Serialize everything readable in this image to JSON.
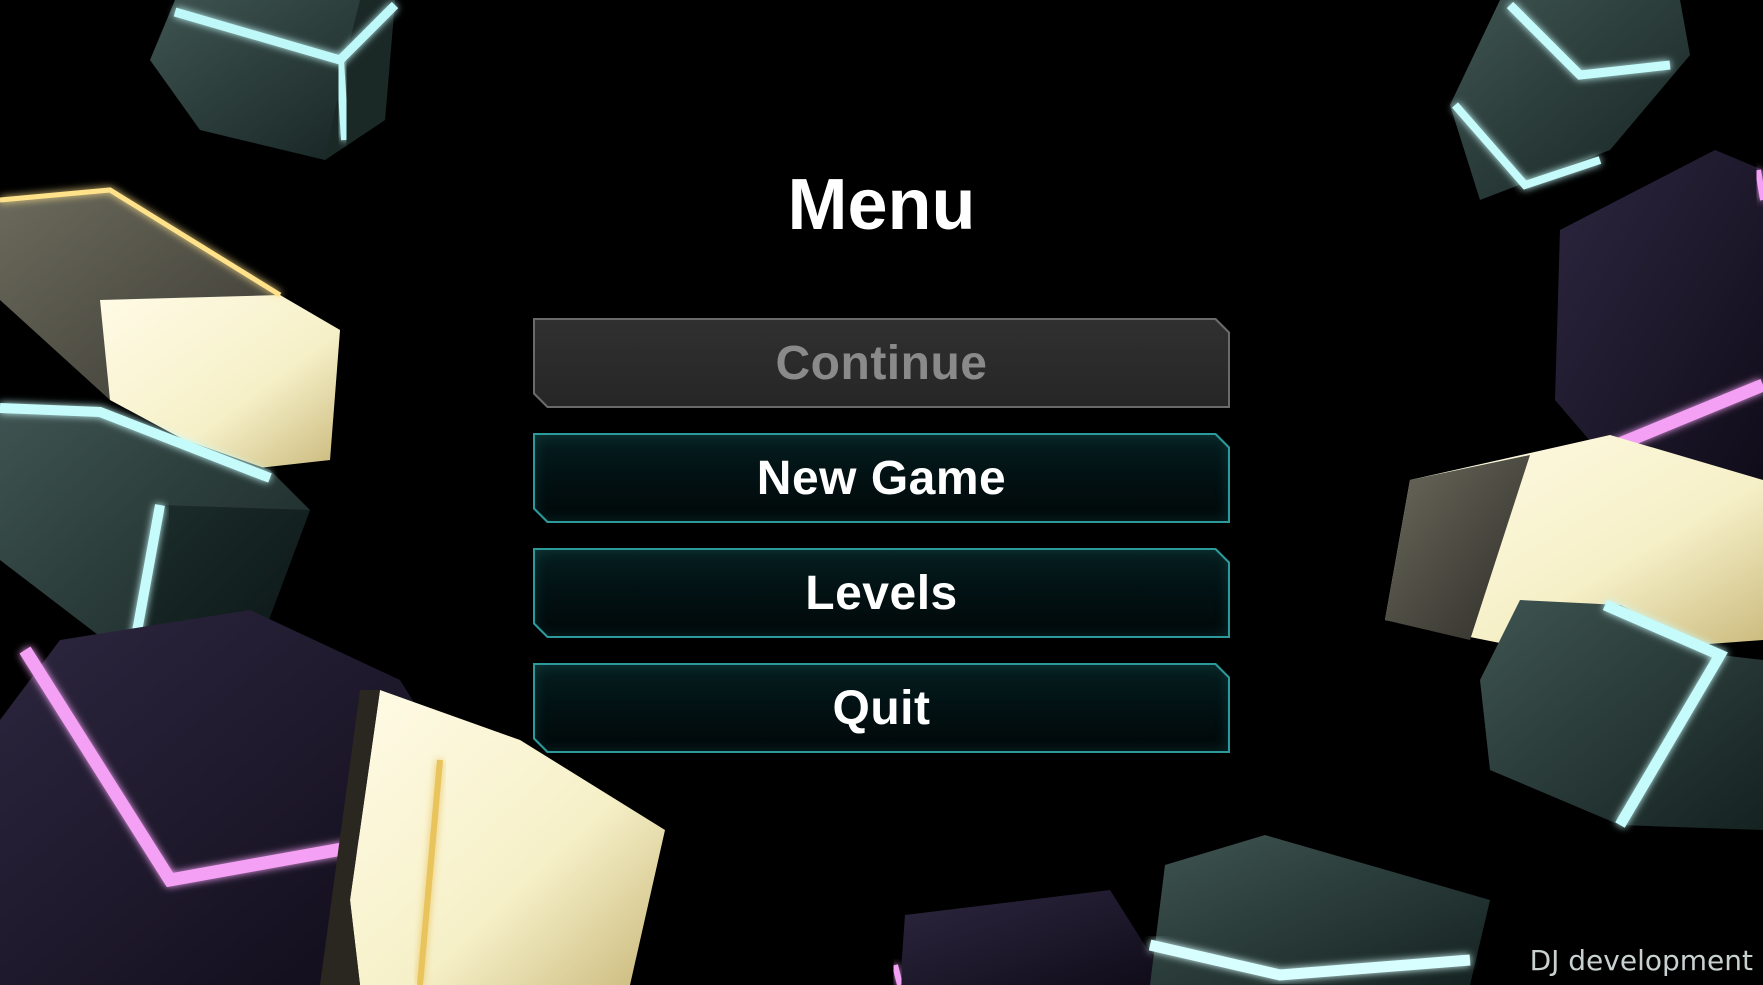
{
  "menu": {
    "title": "Menu",
    "buttons": [
      {
        "label": "Continue",
        "enabled": false
      },
      {
        "label": "New Game",
        "enabled": true
      },
      {
        "label": "Levels",
        "enabled": true
      },
      {
        "label": "Quit",
        "enabled": true
      }
    ]
  },
  "footer": {
    "credit": "DJ development"
  },
  "colors": {
    "button_border": "#2c9a9a",
    "button_fill": "#021214",
    "disabled_border": "#6a6a6a",
    "disabled_fill": "#2a2a2a",
    "glow_cyan": "#9ff6f6",
    "glow_magenta": "#f08cf0",
    "glow_gold": "#f0d47a"
  }
}
